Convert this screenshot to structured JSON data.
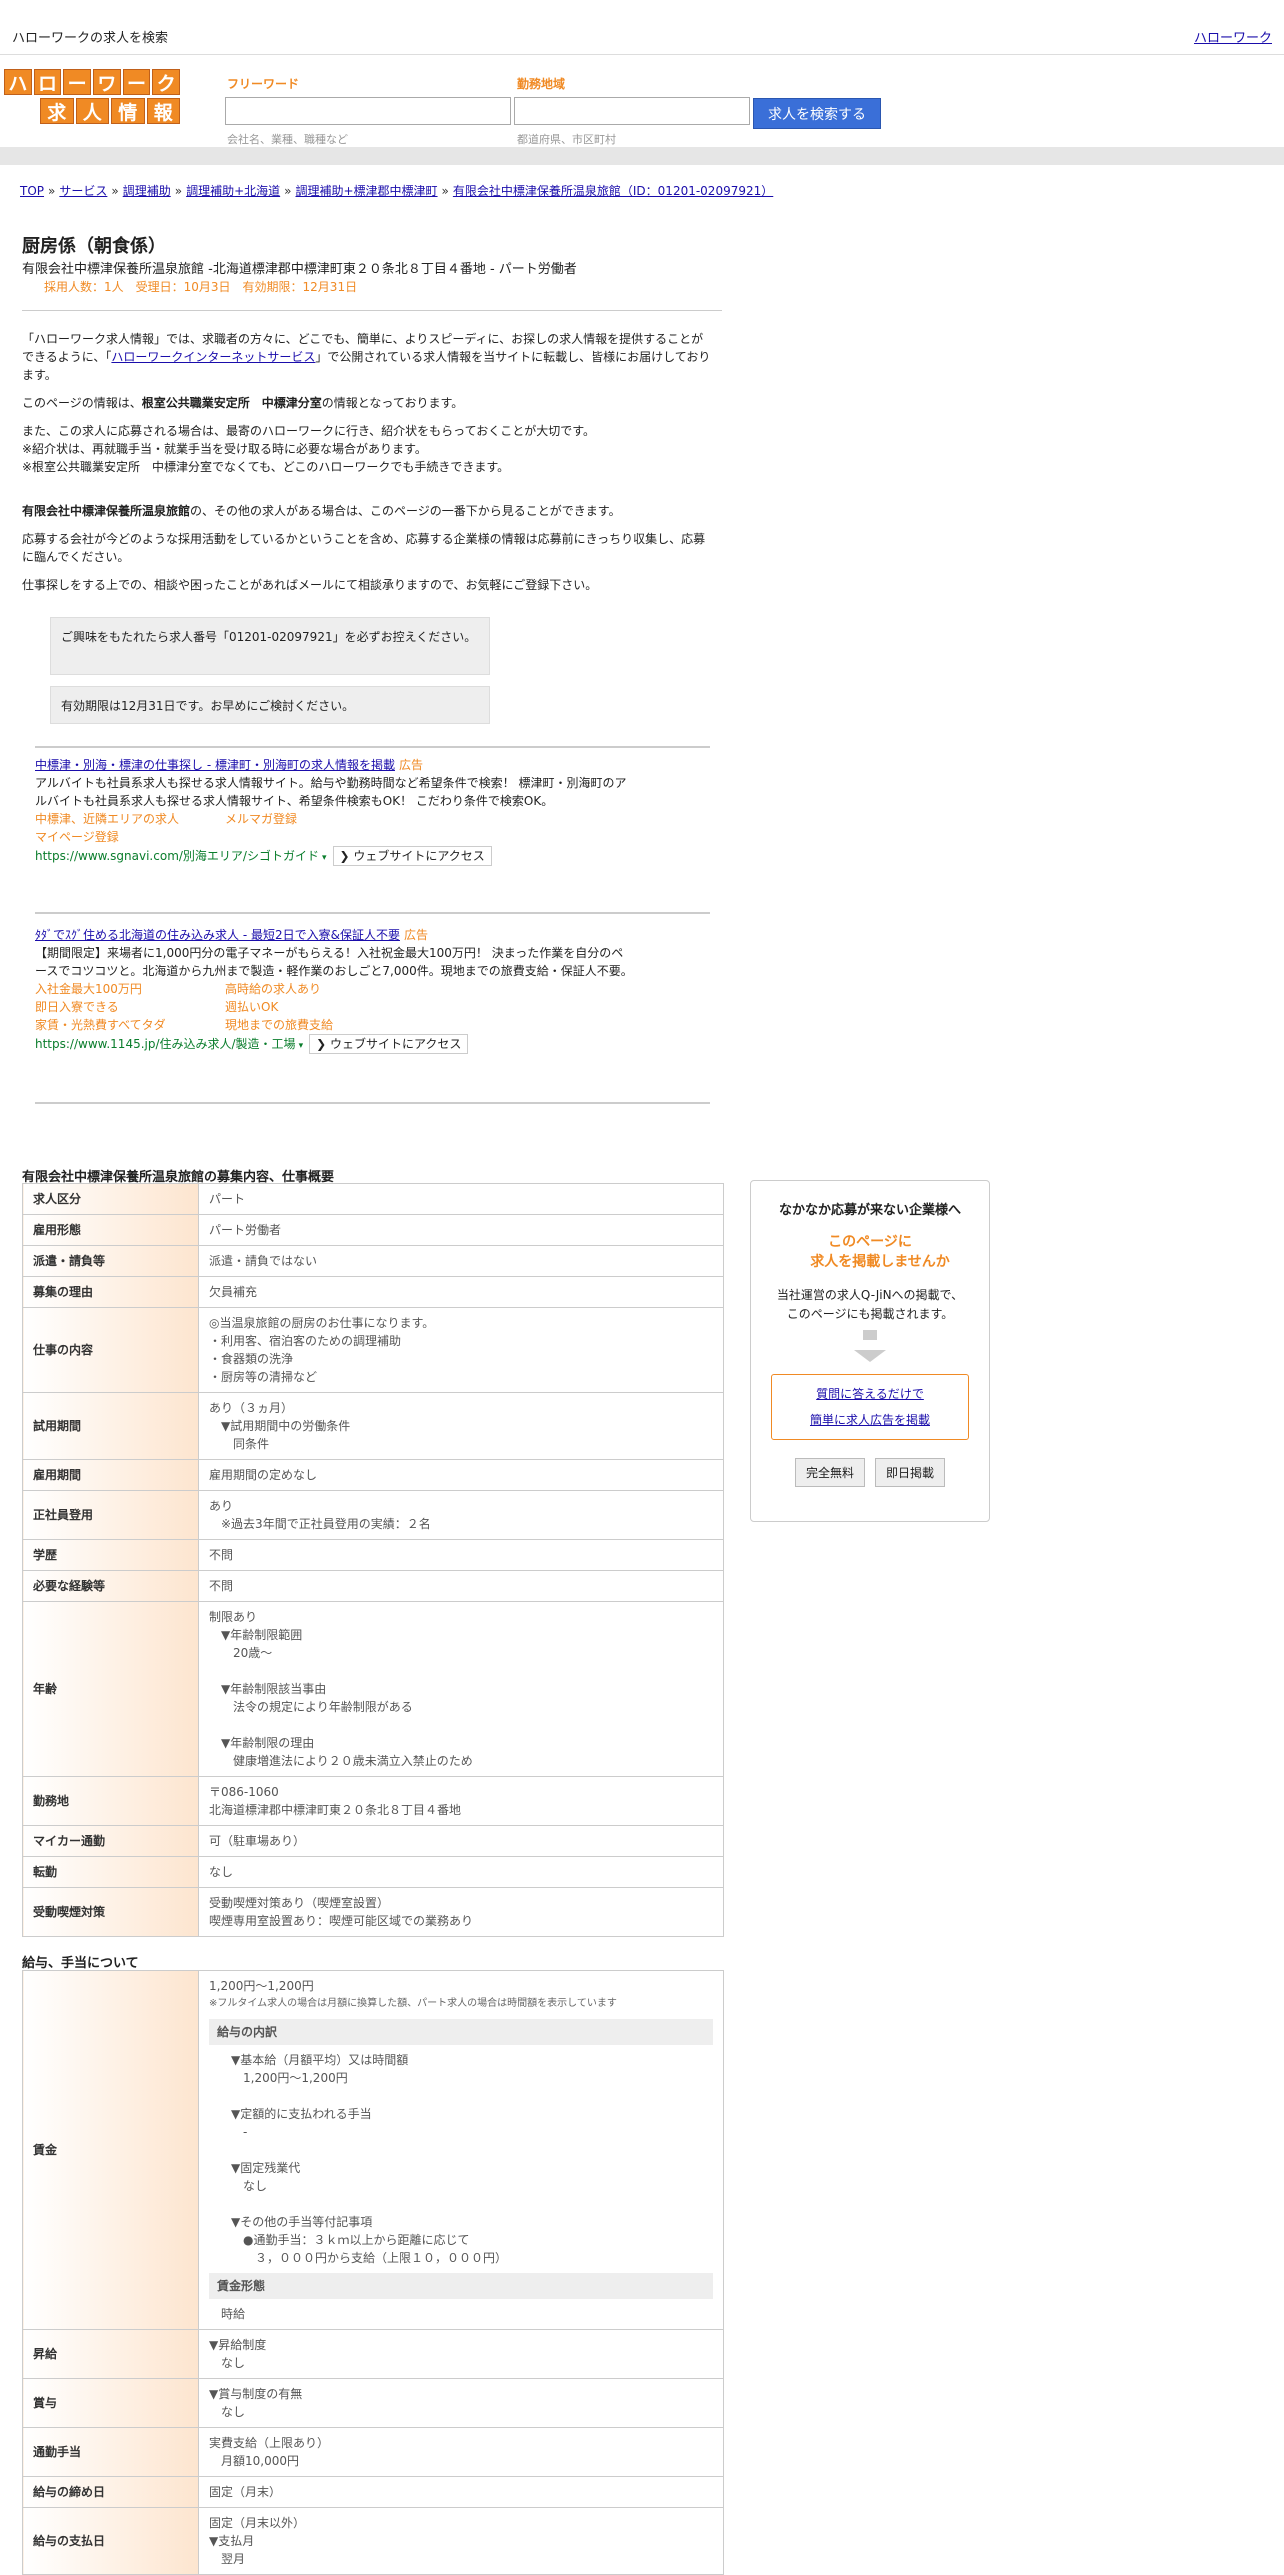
{
  "topbar": {
    "site_title": "ハローワークの求人を検索",
    "home_link": "ハローワーク"
  },
  "logo": {
    "row1": [
      "ハ",
      "ロ",
      "ー",
      "ワ",
      "ー",
      "ク"
    ],
    "row2": [
      "求",
      "人",
      "情",
      "報"
    ]
  },
  "search": {
    "keyword_label": "フリーワード",
    "keyword_placeholder": "会社名、業種、職種など",
    "area_label": "勤務地域",
    "area_placeholder": "都道府県、市区町村",
    "button": "求人を検索する"
  },
  "breadcrumb": [
    "TOP",
    "サービス",
    "調理補助",
    "調理補助+北海道",
    "調理補助+標津郡中標津町",
    "有限会社中標津保養所温泉旅館（ID：01201-02097921）"
  ],
  "job": {
    "title": "厨房係（朝食係）",
    "subtitle": "有限会社中標津保養所温泉旅館 -北海道標津郡中標津町東２０条北８丁目４番地 - パート労働者",
    "meta": "採用人数：1人　受理日：10月3日　有効期限：12月31日"
  },
  "intro": {
    "p1a": "「ハローワーク求人情報」では、求職者の方々に、どこでも、簡単に、よりスピーディに、お探しの求人情報を提供することができるように、「",
    "p1link": "ハローワークインターネットサービス",
    "p1b": "」で公開されている求人情報を当サイトに転載し、皆様にお届けしております。",
    "p2a": "このページの情報は、",
    "p2b": "根室公共職業安定所　中標津分室",
    "p2c": "の情報となっております。",
    "p3": "また、この求人に応募される場合は、最寄のハローワークに行き、紹介状をもらっておくことが大切です。",
    "p3b": "※紹介状は、再就職手当・就業手当を受け取る時に必要な場合があります。",
    "p3c": "※根室公共職業安定所　中標津分室でなくても、どこのハローワークでも手続きできます。",
    "p4a": "有限会社中標津保養所温泉旅館",
    "p4b": "の、その他の求人がある場合は、このページの一番下から見ることができます。",
    "p5": "応募する会社が今どのような採用活動をしているかということを含め、応募する企業様の情報は応募前にきっちり収集し、応募に臨んでください。",
    "p6": "仕事探しをする上での、相談や困ったことがあればメールにて相談承りますので、お気軽にご登録下さい。"
  },
  "notes": {
    "n1": "ご興味をもたれたら求人番号「01201-02097921」を必ずお控えください。",
    "n2": "有効期限は12月31日です。お早めにご検討ください。"
  },
  "ads": [
    {
      "title": "中標津・別海・標津の仕事探し - 標津町・別海町の求人情報を掲載",
      "tag": "広告",
      "body": "アルバイトも社員系求人も探せる求人情報サイト。給与や勤務時間など希望条件で検索！ 標津町・別海町のアルバイトも社員系求人も探せる求人情報サイト、希望条件検索もOK！ こだわり条件で検索OK。",
      "links": [
        "中標津、近隣エリアの求人",
        "メルマガ登録",
        "マイページ登録"
      ],
      "url": "https://www.sgnavi.com/別海エリア/シゴトガイド",
      "visit": "❯ ウェブサイトにアクセス"
    },
    {
      "title": "ﾀﾀﾞでｽｸﾞ住める北海道の住み込み求人 - 最短2日で入寮&保証人不要",
      "tag": "広告",
      "body": "【期間限定】来場者に1,000円分の電子マネーがもらえる！入社祝金最大100万円！ 決まった作業を自分のペースでコツコツと。北海道から九州まで製造・軽作業のおしごと7,000件。現地までの旅費支給・保証人不要。",
      "links": [
        "入社金最大100万円",
        "高時給の求人あり",
        "即日入寮できる",
        "週払いOK",
        "家賃・光熱費すべてタダ",
        "現地までの旅費支給"
      ],
      "url": "https://www.1145.jp/住み込み求人/製造・工場",
      "visit": "❯ ウェブサイトにアクセス"
    }
  ],
  "overview": {
    "title": "有限会社中標津保養所温泉旅館の募集内容、仕事概要",
    "rows": [
      {
        "k": "求人区分",
        "v": "パート"
      },
      {
        "k": "雇用形態",
        "v": "パート労働者"
      },
      {
        "k": "派遣・請負等",
        "v": "派遣・請負ではない"
      },
      {
        "k": "募集の理由",
        "v": "欠員補充"
      },
      {
        "k": "仕事の内容",
        "v": "◎当温泉旅館の厨房のお仕事になります。\n・利用客、宿泊客のための調理補助\n・食器類の洗浄\n・厨房等の清掃など"
      },
      {
        "k": "試用期間",
        "v": "あり（３ヵ月）\n　▼試用期間中の労働条件\n　　同条件"
      },
      {
        "k": "雇用期間",
        "v": "雇用期間の定めなし"
      },
      {
        "k": "正社員登用",
        "v": "あり\n　※過去3年間で正社員登用の実績：２名"
      },
      {
        "k": "学歴",
        "v": "不問"
      },
      {
        "k": "必要な経験等",
        "v": "不問"
      },
      {
        "k": "年齢",
        "v": "制限あり\n　▼年齢制限範囲\n　　20歳〜\n\n　▼年齢制限該当事由\n　　法令の規定により年齢制限がある\n\n　▼年齢制限の理由\n　　健康増進法により２０歳未満立入禁止のため"
      },
      {
        "k": "勤務地",
        "v": "〒086-1060\n北海道標津郡中標津町東２０条北８丁目４番地"
      },
      {
        "k": "マイカー通勤",
        "v": "可（駐車場あり）"
      },
      {
        "k": "転勤",
        "v": "なし"
      },
      {
        "k": "受動喫煙対策",
        "v": "受動喫煙対策あり（喫煙室設置）\n喫煙専用室設置あり：喫煙可能区域での業務あり"
      }
    ]
  },
  "salary": {
    "title": "給与、手当について",
    "wage_range": "1,200円〜1,200円",
    "wage_note": "※フルタイム求人の場合は月額に換算した額、パート求人の場合は時間額を表示しています",
    "breakdown_hd": "給与の内訳",
    "breakdown": "▼基本給（月額平均）又は時間額\n　1,200円〜1,200円\n\n▼定額的に支払われる手当\n　-\n\n▼固定残業代\n　なし\n\n▼その他の手当等付記事項\n　●通勤手当：３ｋｍ以上から距離に応じて\n　　３，０００円から支給（上限１０，０００円）",
    "form_hd": "賃金形態",
    "form": "時給",
    "rows": [
      {
        "k": "賃金"
      },
      {
        "k": "昇給",
        "v": "▼昇給制度\n　なし"
      },
      {
        "k": "賞与",
        "v": "▼賞与制度の有無\n　なし"
      },
      {
        "k": "通勤手当",
        "v": "実費支給（上限あり）\n　月額10,000円"
      },
      {
        "k": "給与の締め日",
        "v": "固定（月末）"
      },
      {
        "k": "給与の支払日",
        "v": "固定（月末以外）\n▼支払月\n　翌月"
      }
    ]
  },
  "sidebox": {
    "title": "なかなか応募が来ない企業様へ",
    "catch1": "このページに",
    "catch2": "求人を掲載しませんか",
    "desc1": "当社運営の求人Q-JiNへの掲載で、",
    "desc2": "このページにも掲載されます。",
    "link1": "質問に答えるだけで",
    "link2": "簡単に求人広告を掲載",
    "btn1": "完全無料",
    "btn2": "即日掲載"
  }
}
